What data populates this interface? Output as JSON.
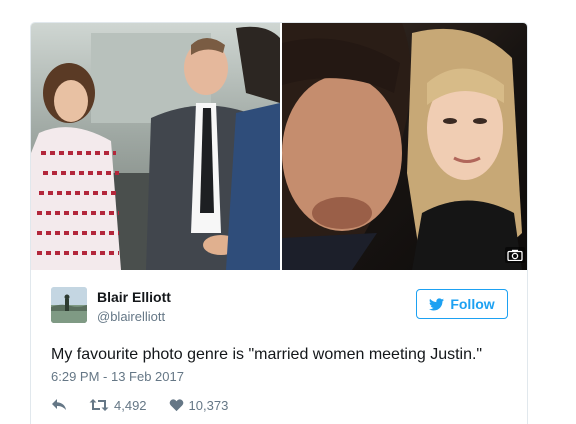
{
  "tweet": {
    "author": {
      "name": "Blair Elliott",
      "handle": "@blairelliott"
    },
    "follow_label": "Follow",
    "text": "My favourite photo genre is \"married women meeting Justin.\"",
    "timestamp": "6:29 PM - 13 Feb 2017",
    "retweet_count": "4,492",
    "like_count": "10,373"
  },
  "icons": {
    "reply": "reply-icon",
    "retweet": "retweet-icon",
    "like": "heart-icon",
    "follow": "twitter-bird-icon",
    "photo_badge": "camera-icon"
  },
  "colors": {
    "accent": "#1da1f2",
    "text": "#14171a",
    "muted": "#657786",
    "border": "#e1e8ed"
  }
}
